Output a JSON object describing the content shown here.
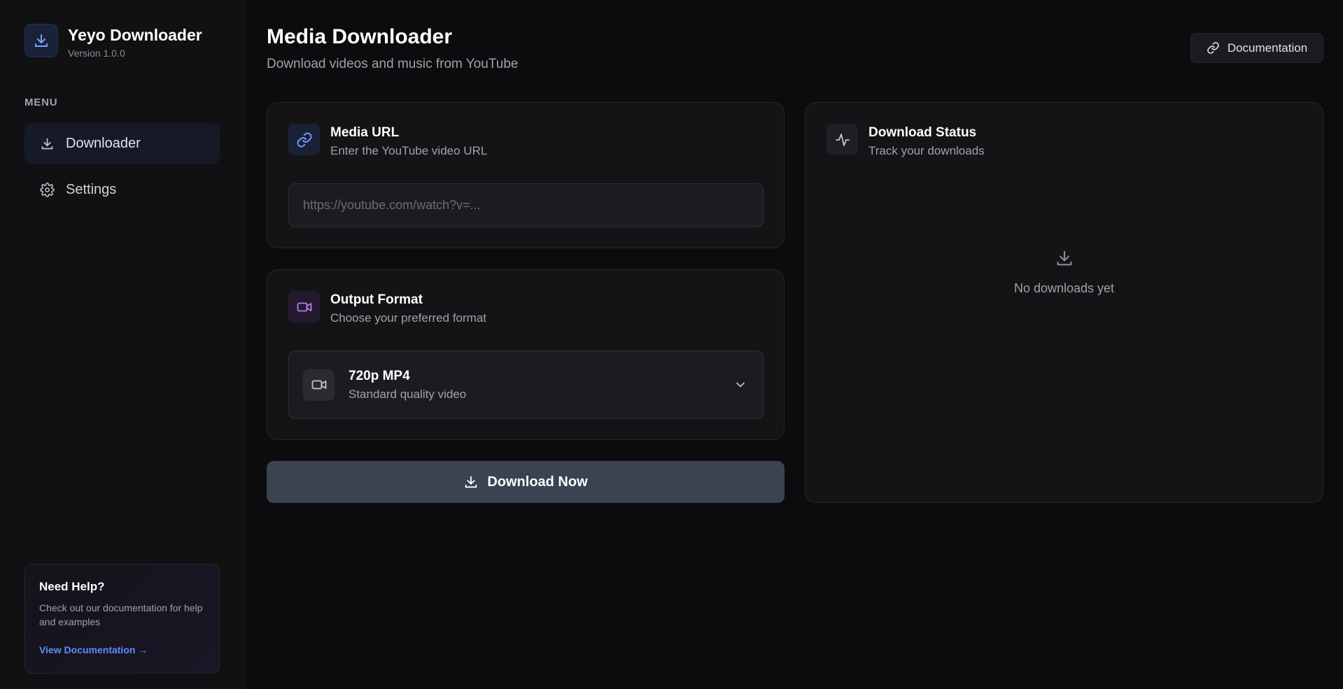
{
  "brand": {
    "title": "Yeyo Downloader",
    "version": "Version 1.0.0"
  },
  "sidebar": {
    "menu_label": "MENU",
    "items": [
      {
        "label": "Downloader",
        "icon": "download-icon",
        "active": true
      },
      {
        "label": "Settings",
        "icon": "gear-icon",
        "active": false
      }
    ],
    "help": {
      "title": "Need Help?",
      "text": "Check out our documentation for help and examples",
      "link": "View Documentation →"
    }
  },
  "header": {
    "title": "Media Downloader",
    "subtitle": "Download videos and music from YouTube",
    "doc_button": "Documentation"
  },
  "url_card": {
    "title": "Media URL",
    "subtitle": "Enter the YouTube video URL",
    "input_value": "",
    "input_placeholder": "https://youtube.com/watch?v=..."
  },
  "format_card": {
    "title": "Output Format",
    "subtitle": "Choose your preferred format",
    "selected_name": "720p MP4",
    "selected_desc": "Standard quality video"
  },
  "download_button": "Download Now",
  "status_card": {
    "title": "Download Status",
    "subtitle": "Track your downloads",
    "empty_text": "No downloads yet"
  },
  "colors": {
    "accent_blue": "#5b8cff",
    "accent_purple": "#b97cf5",
    "background": "#0c0c0e"
  }
}
